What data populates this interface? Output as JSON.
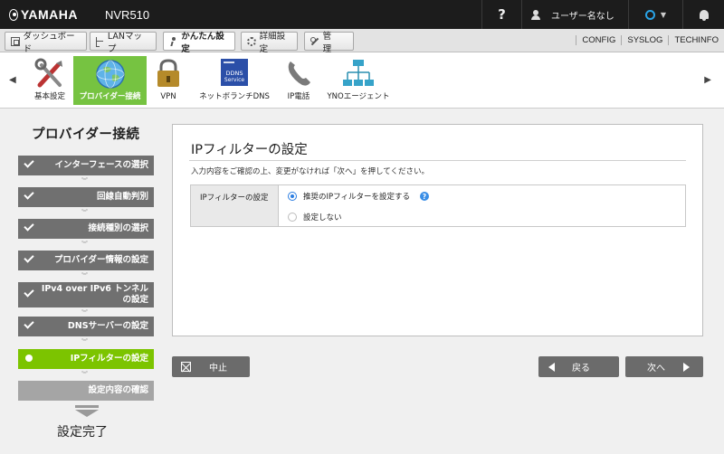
{
  "header": {
    "brand": "YAMAHA",
    "model": "NVR510",
    "help_label": "?",
    "user_label": "ユーザー名なし"
  },
  "main_nav": {
    "buttons": [
      {
        "label": "ダッシュボード",
        "icon": "dashboard-icon"
      },
      {
        "label": "LANマップ",
        "icon": "lan-map-icon"
      },
      {
        "label": "かんたん設定",
        "icon": "easy-setup-icon",
        "active": true
      },
      {
        "label": "詳細設定",
        "icon": "gear-icon"
      },
      {
        "label": "管　理",
        "icon": "wrench-icon"
      }
    ],
    "links": [
      "CONFIG",
      "SYSLOG",
      "TECHINFO"
    ]
  },
  "wizard_bar": {
    "items": [
      {
        "label": "基本設定",
        "icon": "tools-icon"
      },
      {
        "label": "プロバイダー接続",
        "icon": "globe-icon",
        "active": true
      },
      {
        "label": "VPN",
        "icon": "lock-icon"
      },
      {
        "label": "ネットボランチDNS",
        "icon": "dns-service-icon",
        "icon_text_1": "DDNS",
        "icon_text_2": "Service"
      },
      {
        "label": "IP電話",
        "icon": "phone-icon"
      },
      {
        "label": "YNOエージェント",
        "icon": "network-icon"
      }
    ]
  },
  "sidebar": {
    "title": "プロバイダー接続",
    "steps": [
      {
        "label": "インターフェースの選択",
        "state": "done"
      },
      {
        "label": "回線自動判別",
        "state": "done"
      },
      {
        "label": "接続種別の選択",
        "state": "done"
      },
      {
        "label": "プロバイダー情報の設定",
        "state": "done"
      },
      {
        "label_line1": "IPv4 over IPv6 トンネル",
        "label_line2": "の設定",
        "state": "done"
      },
      {
        "label": "DNSサーバーの設定",
        "state": "done"
      },
      {
        "label": "IPフィルターの設定",
        "state": "current"
      },
      {
        "label": "設定内容の確認",
        "state": "future"
      }
    ],
    "completion_label": "設定完了"
  },
  "content": {
    "title": "IPフィルターの設定",
    "description": "入力内容をご確認の上、変更がなければ「次へ」を押してください。",
    "field_label": "IPフィルターの設定",
    "options": [
      {
        "label": "推奨のIPフィルターを設定する",
        "selected": true
      },
      {
        "label": "設定しない",
        "selected": false
      }
    ],
    "help_badge": "?"
  },
  "footer": {
    "cancel_label": "中止",
    "back_label": "戻る",
    "next_label": "次へ"
  },
  "colors": {
    "accent_green": "#76c341",
    "current_step": "#7cc400",
    "done_step": "#707070",
    "future_step": "#a5a5a5",
    "radio_blue": "#2a7de1",
    "topbar": "#1c1c1c"
  }
}
